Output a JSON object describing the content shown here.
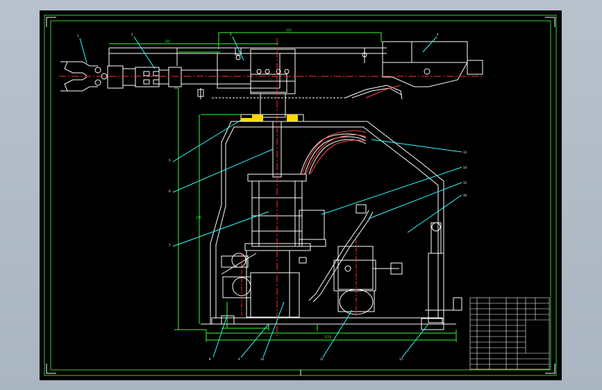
{
  "drawing": {
    "colors": {
      "background": "#000000",
      "frame": "#33d233",
      "geometry": "#ffffff",
      "centerline": "#ff3030",
      "hidden": "#ff3030",
      "dimension": "#30ff30",
      "leader": "#30ffff",
      "highlight": "#ffd700",
      "viewport_bg": "#b3bec8"
    },
    "leader_labels": [
      "1",
      "2",
      "3",
      "4",
      "5",
      "6",
      "7",
      "8",
      "9",
      "10",
      "11",
      "12",
      "13",
      "14",
      "15",
      "16",
      "17"
    ],
    "dimension_labels": [
      "220",
      "120",
      "270",
      "1120"
    ]
  },
  "title_block": {
    "rows": [
      [
        "",
        "",
        "",
        ""
      ],
      [
        "",
        "",
        "",
        ""
      ],
      [
        "",
        "",
        "",
        ""
      ],
      [
        "",
        "",
        "",
        ""
      ],
      [
        "",
        "",
        "",
        ""
      ],
      [
        "",
        "",
        "",
        ""
      ],
      [
        "",
        "",
        "",
        ""
      ],
      [
        "",
        "",
        "",
        ""
      ],
      [
        "",
        "",
        "",
        ""
      ],
      [
        "",
        "",
        "",
        ""
      ],
      [
        "",
        "",
        "",
        ""
      ]
    ]
  }
}
